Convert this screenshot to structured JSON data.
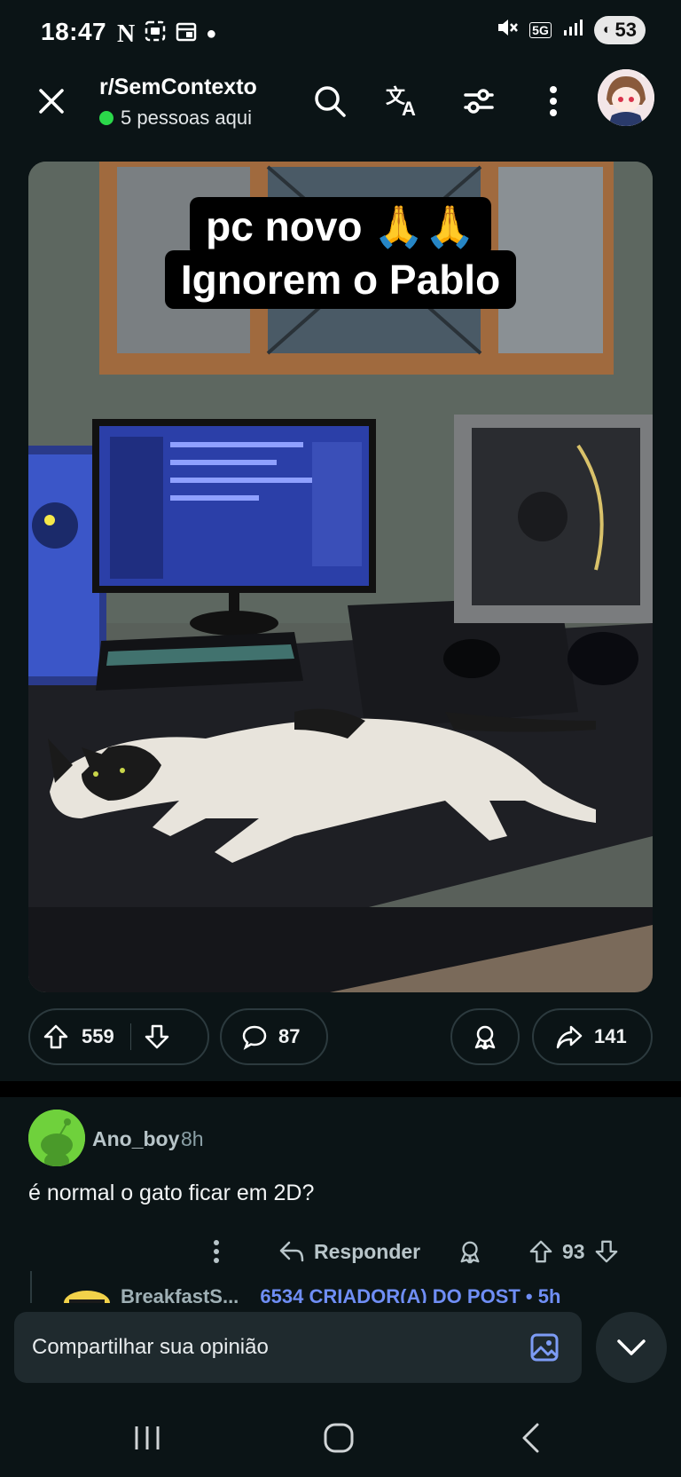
{
  "status_bar": {
    "time": "18:47",
    "left_icons": [
      "netflix-icon",
      "screenshot-icon",
      "calendar-icon",
      "dot-icon"
    ],
    "network": "5G",
    "battery": "53"
  },
  "header": {
    "subreddit": "r/SemContexto",
    "online_text": "5 pessoas aqui"
  },
  "post": {
    "caption_line1": "pc novo 🙏🙏",
    "caption_line2": "Ignorem o Pablo",
    "upvotes": "559",
    "comments": "87",
    "shares": "141"
  },
  "comment": {
    "username": "Ano_boy",
    "time": "8h",
    "body": "é normal o gato ficar em 2D?",
    "reply_label": "Responder",
    "votes": "93"
  },
  "next_comment": {
    "text": "BreakfastS...",
    "op_label": "6534 CRIADOR(A) DO POST • 5h"
  },
  "input": {
    "placeholder": "Compartilhar sua opinião"
  },
  "colors": {
    "background": "#0b1416",
    "online_dot": "#2bd84a",
    "pill_border": "#2c3a3e",
    "op_label": "#6f8ef5"
  }
}
